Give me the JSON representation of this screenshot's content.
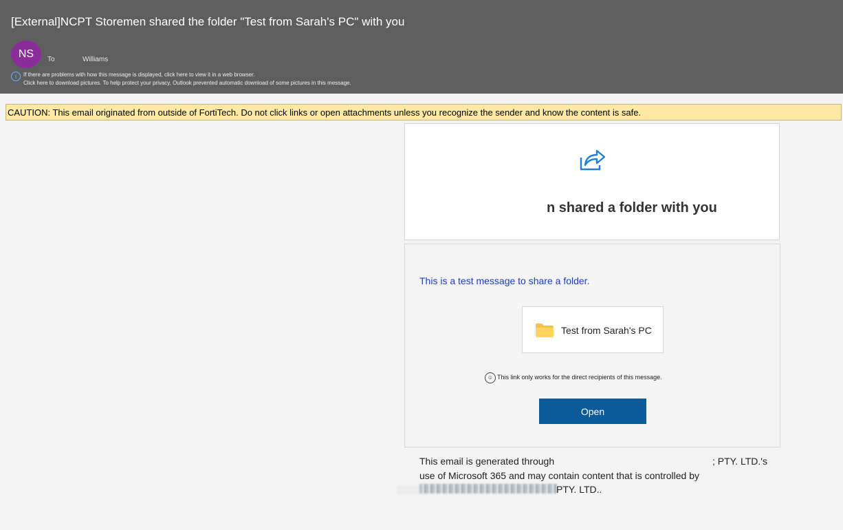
{
  "header": {
    "subject": "[External]NCPT Storemen shared the folder \"Test from Sarah's PC\" with you",
    "avatar_initials": "NS",
    "avatar_color": "#8a2d9a",
    "to_label": "To",
    "to_name": "Williams",
    "info_line_1": "If there are problems with how this message is displayed, click here to view it in a web browser.",
    "info_line_2": "Click here to download pictures. To help protect your privacy, Outlook prevented automatic download of some pictures in this message."
  },
  "caution": {
    "text": "CAUTION: This email originated from outside of FortiTech. Do not click links or open attachments unless you recognize the sender and know the content is safe."
  },
  "share_card": {
    "icon": "share-icon",
    "heading": "n shared a folder with you"
  },
  "main_card": {
    "message": "This is a test message to share a folder.",
    "folder_icon": "folder-icon",
    "folder_name": "Test from Sarah's PC",
    "note": "This link only works for the direct recipients of this message.",
    "open_button": "Open"
  },
  "footer": {
    "line1_start": "This email is generated through",
    "line1_end": "; PTY. LTD.'s",
    "line2": "use of Microsoft 365 and may contain content that is controlled by",
    "line3_end": "PTY. LTD.."
  },
  "colors": {
    "header_bg": "#5e5e5e",
    "caution_bg": "#fde9a3",
    "button_bg": "#0b5a9a",
    "message_text": "#1a3cc8",
    "folder": "#f5c242"
  }
}
